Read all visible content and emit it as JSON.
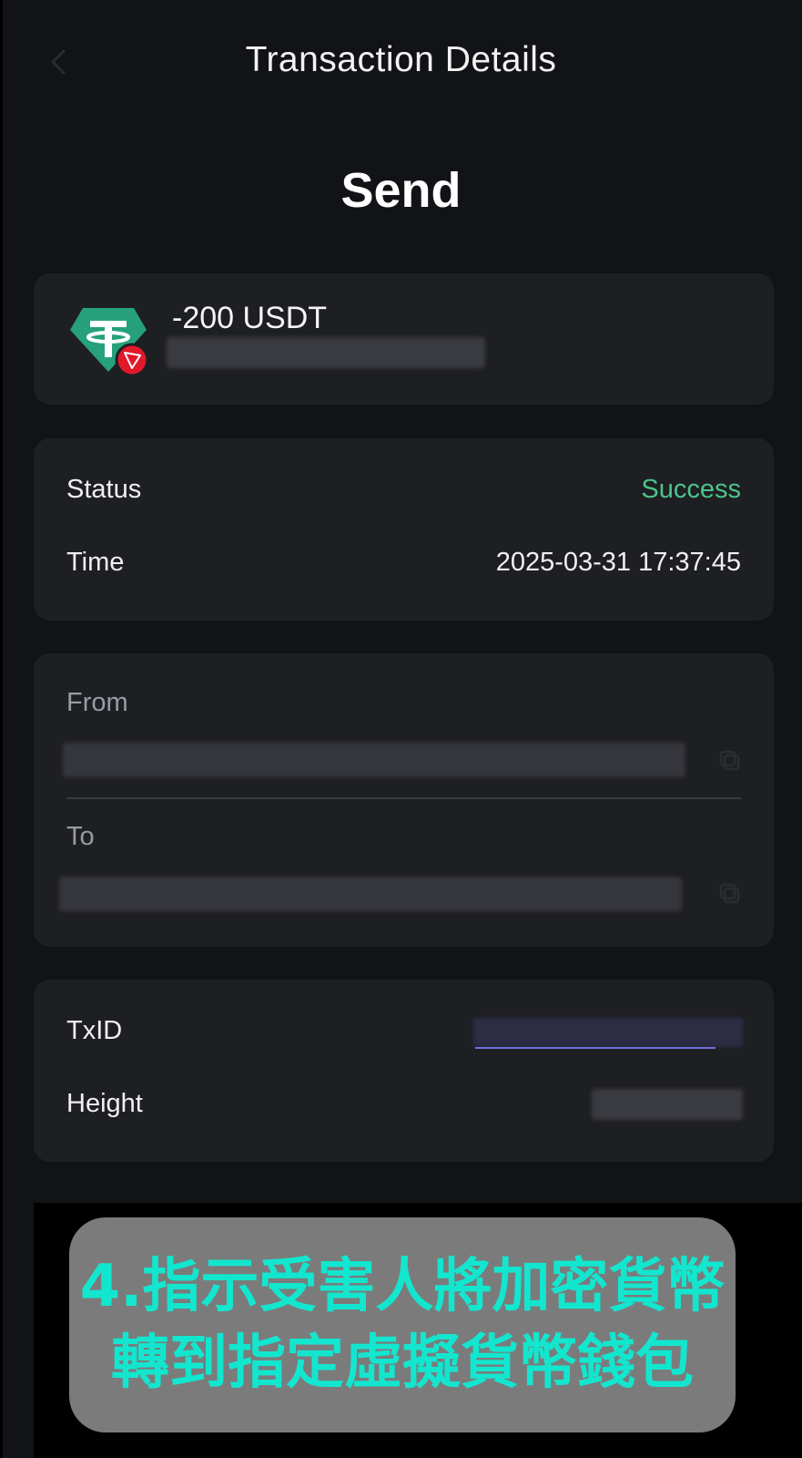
{
  "header": {
    "title": "Transaction Details",
    "back_icon": "chevron-left-icon"
  },
  "page_title": "Send",
  "asset": {
    "amount": "-200 USDT",
    "token_icon": "tether-usdt-icon",
    "network_badge_icon": "tron-icon"
  },
  "status": {
    "status_label": "Status",
    "status_value": "Success",
    "time_label": "Time",
    "time_value": "2025-03-31 17:37:45"
  },
  "addresses": {
    "from_label": "From",
    "to_label": "To",
    "copy_icon": "copy-icon"
  },
  "tx": {
    "txid_label": "TxID",
    "height_label": "Height"
  },
  "caption": {
    "line1": "4.指示受害人將加密貨幣",
    "line2": "轉到指定虛擬貨幣錢包"
  },
  "colors": {
    "background": "#121316",
    "card": "#1e1f23",
    "success": "#4cc38a",
    "caption_text": "#13e6cf",
    "caption_box": "#7b7b7b",
    "tether": "#26a17b",
    "tron": "#e0182a"
  }
}
